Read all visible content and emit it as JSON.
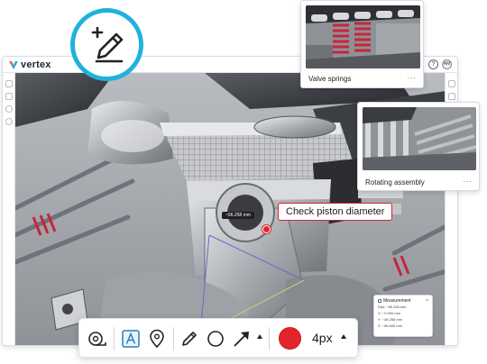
{
  "app": {
    "brand_name": "vertex",
    "help_glyph": "?",
    "user_initials": "AM"
  },
  "viewport": {
    "annotation_callout": "Check piston diameter",
    "dimension_label": "~96.258 mm"
  },
  "measurement_panel": {
    "title": "Measurement",
    "close_glyph": "×",
    "rows": [
      "Dist: ~96.258 mm",
      "X: ~0.000 mm",
      "Y: ~48.258 mm",
      "Z: ~96.840 mm"
    ]
  },
  "toolbar": {
    "tools": [
      "tape-measure-tool",
      "text-tool",
      "pin-tool",
      "pencil-tool",
      "circle-tool",
      "arrow-tool"
    ],
    "active_color": "#e3242b",
    "stroke_size_label": "4px"
  },
  "thumbnails": [
    {
      "caption": "Valve springs",
      "menu_glyph": "···"
    },
    {
      "caption": "Rotating assembly",
      "menu_glyph": "···"
    }
  ],
  "colors": {
    "accent_cyan": "#1fb2dd",
    "annotation_red": "#e02430",
    "spring_red": "#c8253a"
  }
}
